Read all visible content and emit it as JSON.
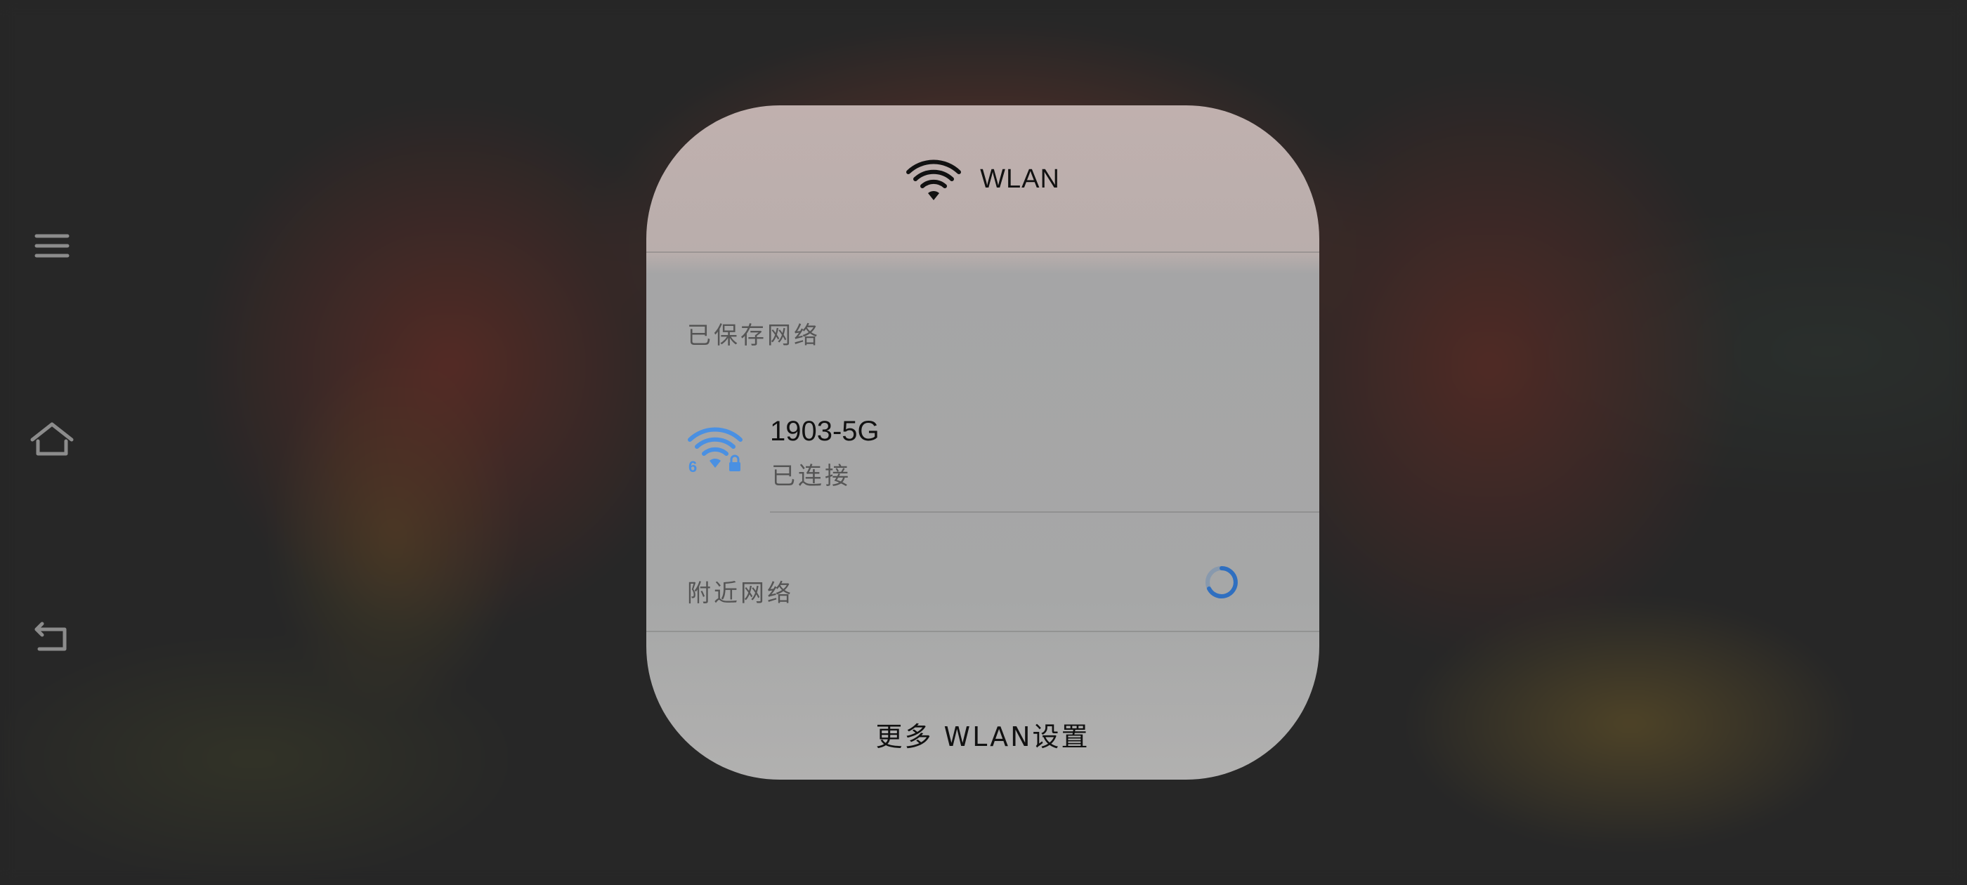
{
  "wlan_panel": {
    "title": "WLAN",
    "saved_networks_label": "已保存网络",
    "saved_networks": [
      {
        "name": "1903-5G",
        "status": "已连接",
        "wifi_generation": "6",
        "secured": true,
        "icon": "wifi-6-lock-icon"
      }
    ],
    "nearby_networks_label": "附近网络",
    "more_settings_label": "更多 WLAN设置"
  },
  "nav": {
    "menu_icon": "menu-icon",
    "home_icon": "home-icon",
    "back_icon": "back-icon"
  },
  "colors": {
    "accent": "#4a90e2",
    "spinner": "#2f6fc0"
  }
}
